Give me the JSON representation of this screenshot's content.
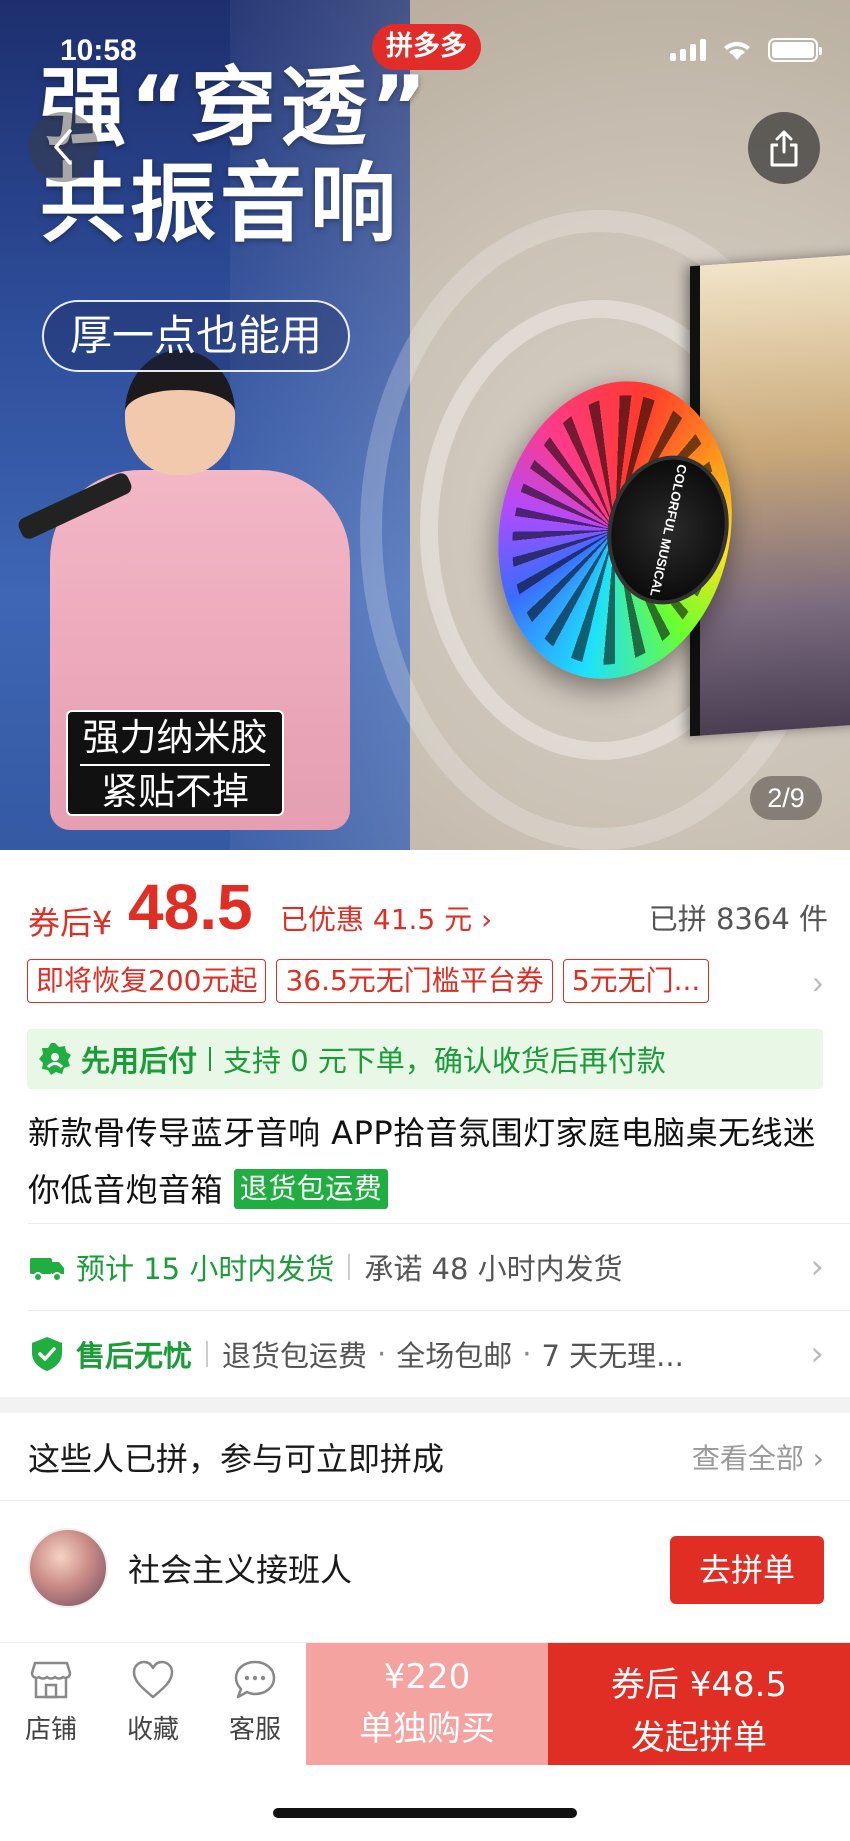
{
  "status_bar": {
    "time": "10:58",
    "badge": "拼多多"
  },
  "hero": {
    "headline_line1": "强“穿透”",
    "headline_line2": "共振音响",
    "pill_text": "厚一点也能用",
    "glue_line1": "强力纳米胶",
    "glue_line2": "紧贴不掉",
    "speaker_logo": "COLORFUL MUSICAL",
    "image_counter": "2/9"
  },
  "price": {
    "prefix": "券后",
    "currency": "¥",
    "value": "48.5",
    "discount": "已优惠 41.5 元 ›",
    "sold": "已拼 8364 件"
  },
  "coupons": [
    "即将恢复200元起",
    "36.5元无门槛平台券",
    "5元无门..."
  ],
  "paylater": {
    "title": "先用后付",
    "desc": "支持 0 元下单，确认收货后再付款"
  },
  "product": {
    "title": "新款骨传导蓝牙音响 APP拾音氛围灯家庭电脑桌无线迷你低音炮音箱",
    "tag": "退货包运费"
  },
  "shipping": {
    "main": "预计 15 小时内发货",
    "sub": "承诺 48 小时内发货"
  },
  "aftersale": {
    "main": "售后无忧",
    "items": [
      "退货包运费",
      "全场包邮",
      "7 天无理..."
    ]
  },
  "group_buy": {
    "heading": "这些人已拼，参与可立即拼成",
    "see_all": "查看全部 ›",
    "member_name": "社会主义接班人",
    "join_label": "去拼单"
  },
  "bottom_bar": {
    "store": "店铺",
    "favorite": "收藏",
    "service": "客服",
    "single_price": "¥220",
    "single_label": "单独购买",
    "group_price": "券后 ¥48.5",
    "group_label": "发起拼单"
  },
  "colors": {
    "accent": "#e02e24",
    "green": "#1a9c38"
  }
}
